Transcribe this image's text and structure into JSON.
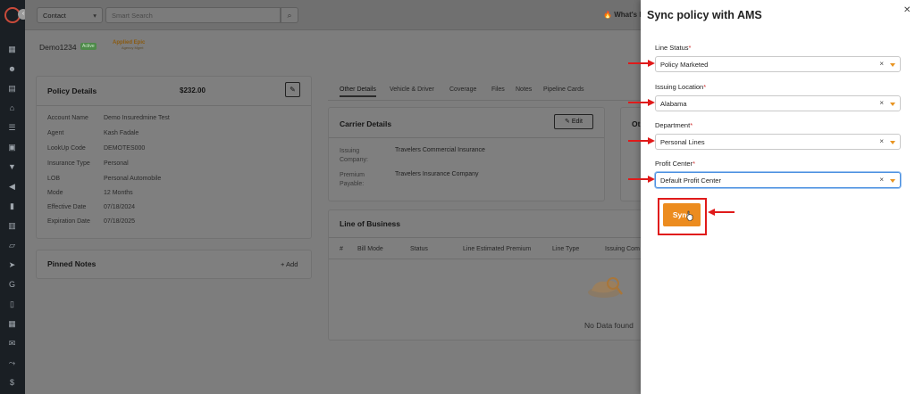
{
  "topbar": {
    "context_select": "Contact",
    "search_placeholder": "Smart Search",
    "whats_new": "What's N"
  },
  "account": {
    "name": "Demo1234",
    "status": "Active",
    "applied_logo": "Applied Epic",
    "applied_logo_sub": "Agency Mgmt"
  },
  "policy": {
    "title": "Policy Details",
    "amount": "$232.00",
    "fields": [
      {
        "k": "Account Name",
        "v": "Demo Insuredmine Test"
      },
      {
        "k": "Agent",
        "v": "Kash Fadale"
      },
      {
        "k": "LookUp Code",
        "v": "DEMOTES000"
      },
      {
        "k": "Insurance Type",
        "v": "Personal"
      },
      {
        "k": "LOB",
        "v": "Personal Automobile"
      },
      {
        "k": "Mode",
        "v": "12 Months"
      },
      {
        "k": "Effective Date",
        "v": "07/18/2024"
      },
      {
        "k": "Expiration Date",
        "v": "07/18/2025"
      }
    ]
  },
  "pinned": {
    "title": "Pinned Notes",
    "add": "+ Add"
  },
  "tabs": [
    "Other Details",
    "Vehicle & Driver",
    "Coverage",
    "Files",
    "Notes",
    "Pipeline Cards"
  ],
  "carrier": {
    "title": "Carrier Details",
    "edit": "Edit",
    "issuing_label": "Issuing Company:",
    "issuing_value": "Travelers Commercial Insurance",
    "premium_label": "Premium Payable:",
    "premium_value": "Travelers Insurance Company"
  },
  "other_card_title": "Ot",
  "lob": {
    "title": "Line of Business",
    "columns": [
      "#",
      "Bill Mode",
      "Status",
      "Line Estimated Premium",
      "Line Type",
      "Issuing Com"
    ],
    "empty": "No Data found"
  },
  "panel": {
    "title": "Sync policy with AMS",
    "fields": [
      {
        "label": "Line Status",
        "value": "Policy Marketed"
      },
      {
        "label": "Issuing Location",
        "value": "Alabama"
      },
      {
        "label": "Department",
        "value": "Personal Lines"
      },
      {
        "label": "Profit Center",
        "value": "Default Profit Center"
      }
    ],
    "sync_button": "Sync",
    "required_mark": "*"
  },
  "colors": {
    "accent": "#ec8c1f",
    "highlight": "#e01a1a",
    "focus": "#4a8fe0"
  }
}
